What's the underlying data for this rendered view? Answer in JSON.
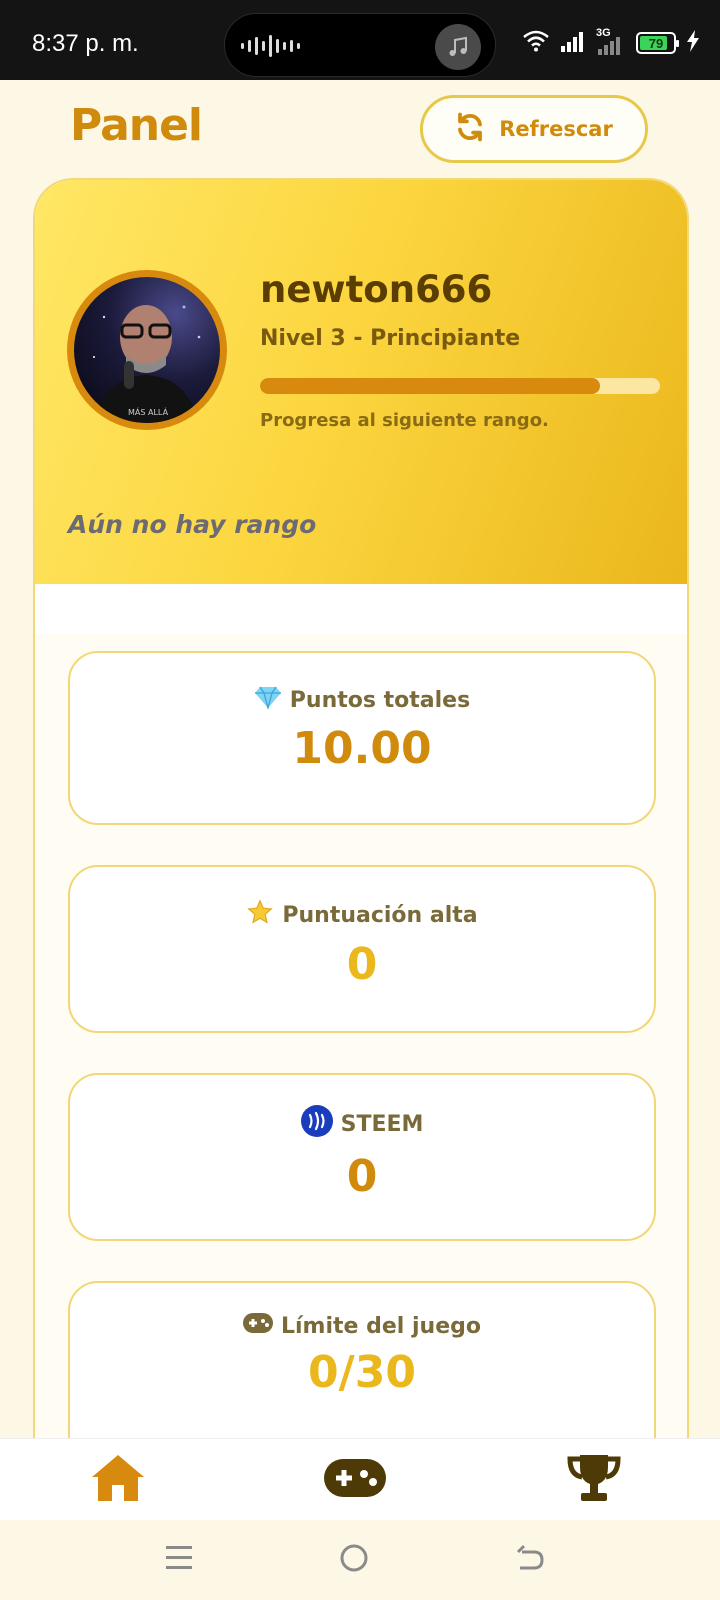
{
  "status": {
    "time": "8:37 p. m.",
    "network": "3G",
    "battery": "79"
  },
  "header": {
    "title": "Panel",
    "refresh_label": "Refrescar"
  },
  "profile": {
    "username": "newton666",
    "level": "Nivel 3 - Principiante",
    "progress": 0.85,
    "progress_caption": "Progresa al siguiente rango.",
    "rank": "Aún no hay rango"
  },
  "stats": [
    {
      "icon": "gem-icon",
      "label": "Puntos totales",
      "value": "10.00",
      "color": "#d08a0c"
    },
    {
      "icon": "star-icon",
      "label": "Puntuación alta",
      "value": "0",
      "color": "#eab71c"
    },
    {
      "icon": "steem-icon",
      "label": "STEEM",
      "value": "0",
      "color": "#d08a0c"
    },
    {
      "icon": "gamepad-icon",
      "label": "Límite del juego",
      "value": "0/30",
      "color": "#eab71c"
    }
  ],
  "bottom_nav": {
    "items": [
      {
        "icon": "home-icon",
        "active": true
      },
      {
        "icon": "gamepad-icon",
        "active": false
      },
      {
        "icon": "trophy-icon",
        "active": false
      }
    ]
  },
  "colors": {
    "accent": "#d08a0c",
    "gold": "#eab71c",
    "background": "#fdf8e6"
  }
}
